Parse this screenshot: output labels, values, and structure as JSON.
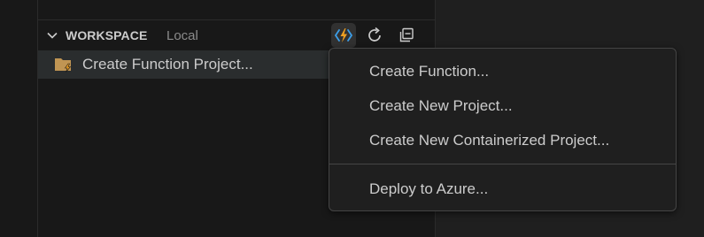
{
  "workspace": {
    "title": "WORKSPACE",
    "subtitle": "Local",
    "toolbar": {
      "functions_icon": "azure-functions-icon",
      "refresh_icon": "refresh-icon",
      "collapse_icon": "collapse-all-icon"
    }
  },
  "tree": {
    "items": [
      {
        "label": "Create Function Project...",
        "icon": "folder-lightning-icon"
      }
    ]
  },
  "context_menu": {
    "items": [
      {
        "label": "Create Function..."
      },
      {
        "label": "Create New Project..."
      },
      {
        "label": "Create New Containerized Project..."
      },
      {
        "label": "Deploy to Azure..."
      }
    ]
  },
  "colors": {
    "background": "#181818",
    "menu_background": "#1f1f1f",
    "text": "#cccccc",
    "muted": "#8b8b8b",
    "accent_lightning": "#f0a020",
    "accent_blue": "#3c9ee8"
  }
}
